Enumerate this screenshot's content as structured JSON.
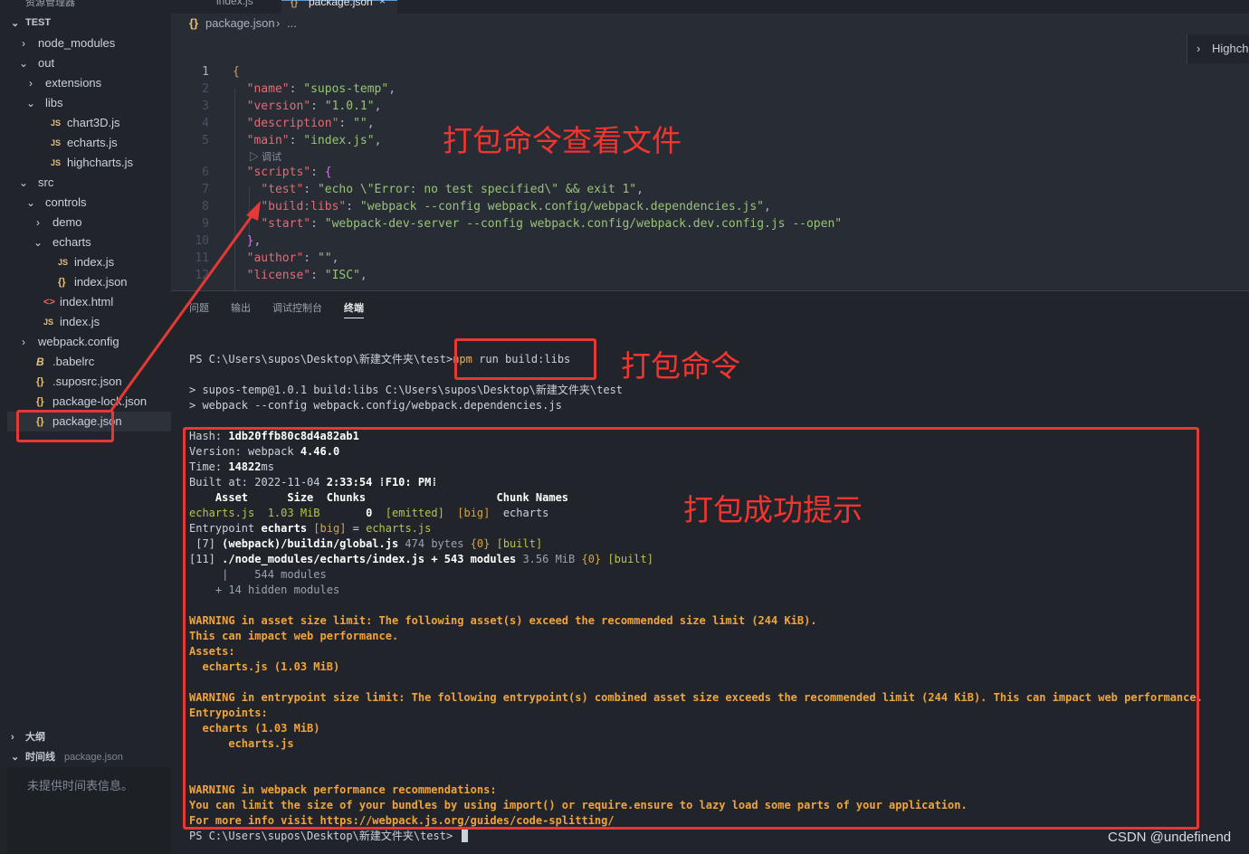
{
  "sidebar": {
    "top_title": "资源管理器",
    "root": "TEST",
    "items": [
      {
        "label": "node_modules",
        "chev": "›",
        "type": "folder"
      },
      {
        "label": "out",
        "chev": "⌄",
        "type": "folder"
      },
      {
        "label": "extensions",
        "chev": "›",
        "type": "folder"
      },
      {
        "label": "libs",
        "chev": "⌄",
        "type": "folder"
      },
      {
        "label": "chart3D.js",
        "icon": "JS",
        "type": "js"
      },
      {
        "label": "echarts.js",
        "icon": "JS",
        "type": "js"
      },
      {
        "label": "highcharts.js",
        "icon": "JS",
        "type": "js"
      },
      {
        "label": "src",
        "chev": "⌄",
        "type": "folder"
      },
      {
        "label": "controls",
        "chev": "⌄",
        "type": "folder"
      },
      {
        "label": "demo",
        "chev": "›",
        "type": "folder"
      },
      {
        "label": "echarts",
        "chev": "⌄",
        "type": "folder"
      },
      {
        "label": "index.js",
        "icon": "JS",
        "type": "js"
      },
      {
        "label": "index.json",
        "icon": "{}",
        "type": "json"
      },
      {
        "label": "index.html",
        "icon": "<>",
        "type": "html"
      },
      {
        "label": "index.js",
        "icon": "JS",
        "type": "js"
      },
      {
        "label": "webpack.config",
        "chev": "›",
        "type": "folder"
      },
      {
        "label": ".babelrc",
        "icon": "B",
        "type": "babel"
      },
      {
        "label": ".suposrc.json",
        "icon": "{}",
        "type": "json"
      },
      {
        "label": "package-lock.json",
        "icon": "{}",
        "type": "json"
      },
      {
        "label": "package.json",
        "icon": "{}",
        "type": "json",
        "selected": true
      }
    ],
    "outline": "大纲",
    "timeline": "时间线",
    "timeline_file": "package.json",
    "timeline_msg": "未提供时间表信息。"
  },
  "tabs": {
    "inactive": "index.js",
    "active": "package.json",
    "close": "×"
  },
  "breadcrumb": {
    "icon": "{}",
    "file": "package.json",
    "sep": "›",
    "rest": "..."
  },
  "editor": {
    "codelens": "▷ 调试",
    "minimap_label": "Highch",
    "minimap_chev": "›",
    "lines": [
      {
        "n": "1",
        "html": "<span class='brace'>{</span>"
      },
      {
        "n": "2",
        "html": "  <span class='k'>\"name\"</span><span class='p'>: </span><span class='s'>\"supos-temp\"</span><span class='p'>,</span>"
      },
      {
        "n": "3",
        "html": "  <span class='k'>\"version\"</span><span class='p'>: </span><span class='s'>\"1.0.1\"</span><span class='p'>,</span>"
      },
      {
        "n": "4",
        "html": "  <span class='k'>\"description\"</span><span class='p'>: </span><span class='s'>\"\"</span><span class='p'>,</span>"
      },
      {
        "n": "5",
        "html": "  <span class='k'>\"main\"</span><span class='p'>: </span><span class='s'>\"index.js\"</span><span class='p'>,</span>"
      },
      {
        "n": "6",
        "html": "  <span class='k'>\"scripts\"</span><span class='p'>: </span><span class='brace2'>{</span>"
      },
      {
        "n": "7",
        "html": "    <span class='k'>\"test\"</span><span class='p'>: </span><span class='s'>\"echo \\\"Error: no test specified\\\" &amp;&amp; exit 1\"</span><span class='p'>,</span>"
      },
      {
        "n": "8",
        "html": "    <span class='k'>\"build:libs\"</span><span class='p'>: </span><span class='s'>\"webpack --config webpack.config/webpack.dependencies.js\"</span><span class='p'>,</span>"
      },
      {
        "n": "9",
        "html": "    <span class='k'>\"start\"</span><span class='p'>: </span><span class='s'>\"webpack-dev-server --config webpack.config/webpack.dev.config.js --open\"</span>"
      },
      {
        "n": "10",
        "html": "  <span class='brace2'>}</span><span class='p'>,</span>"
      },
      {
        "n": "11",
        "html": "  <span class='k'>\"author\"</span><span class='p'>: </span><span class='s'>\"\"</span><span class='p'>,</span>"
      },
      {
        "n": "12",
        "html": "  <span class='k'>\"license\"</span><span class='p'>: </span><span class='s'>\"ISC\"</span><span class='p'>,</span>"
      }
    ]
  },
  "panel": {
    "tabs": [
      "问题",
      "输出",
      "调试控制台",
      "终端"
    ],
    "active_tab": "终端"
  },
  "terminal": {
    "prompt": "PS C:\\Users\\supos\\Desktop\\新建文件夹\\test>",
    "command": "npm run build:libs",
    "run1": "> supos-temp@1.0.1 build:libs C:\\Users\\supos\\Desktop\\新建文件夹\\test",
    "run2": "> webpack --config webpack.config/webpack.dependencies.js",
    "hash_label": "Hash: ",
    "hash": "1db20ffb80c8d4a82ab1",
    "version_label": "Version: webpack ",
    "version": "4.46.0",
    "time_label": "Time: ",
    "time": "14822",
    "time_unit": "ms",
    "built_label": "Built at: 2022-11-04 ",
    "built_time": "2:33:54",
    "built_rest": " ⁞F10: PM⁞",
    "table_header": "    Asset      Size  Chunks                    Chunk Names",
    "asset_name": "echarts.js",
    "asset_size": "1.03 MiB",
    "asset_chunk": "0",
    "asset_emitted": "[emitted]",
    "asset_big": "[big]",
    "asset_chunkname": "echarts",
    "entry_label": "Entrypoint ",
    "entry_name": "echarts",
    "entry_big": "[big]",
    "entry_eq": " = ",
    "entry_file": "echarts.js",
    "mod1_id": " [7] ",
    "mod1_name": "(webpack)/buildin/global.js",
    "mod1_size": " 474 bytes ",
    "mod1_chunk": "{0}",
    "mod1_built": "[built]",
    "mod2_id": "[11] ",
    "mod2_name": "./node_modules/echarts/index.js + 543 modules",
    "mod2_size": " 3.56 MiB ",
    "mod2_chunk": "{0}",
    "mod2_built": "[built]",
    "sub1": "     |    544 modules",
    "sub2": "    + 14 hidden modules",
    "warn1": "WARNING in asset size limit: The following asset(s) exceed the recommended size limit (244 KiB).",
    "warn1b": "This can impact web performance.",
    "warn1c": "Assets:",
    "warn1d": "  echarts.js (1.03 MiB)",
    "warn2": "WARNING in entrypoint size limit: The following entrypoint(s) combined asset size exceeds the recommended limit (244 KiB). This can impact web performance.",
    "warn2b": "Entrypoints:",
    "warn2c": "  echarts (1.03 MiB)",
    "warn2d": "      echarts.js",
    "warn3": "WARNING in webpack performance recommendations:",
    "warn3b": "You can limit the size of your bundles by using import() or require.ensure to lazy load some parts of your application.",
    "warn3c": "For more info visit https://webpack.js.org/guides/code-splitting/",
    "final_prompt": "PS C:\\Users\\supos\\Desktop\\新建文件夹\\test> "
  },
  "annotations": {
    "view_file": "打包命令查看文件",
    "command": "打包命令",
    "success": "打包成功提示",
    "color": "#e53935"
  },
  "watermark": "CSDN @undefinend"
}
